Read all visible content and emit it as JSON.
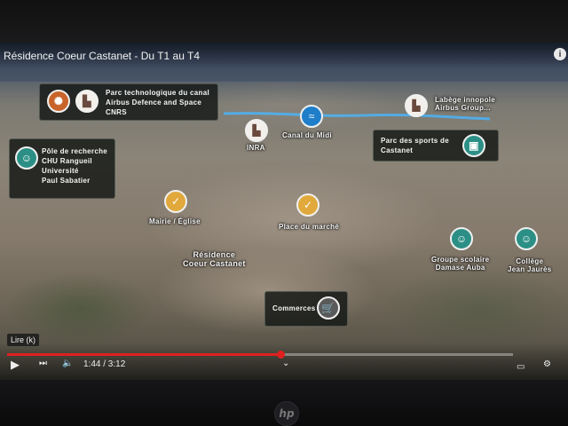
{
  "video": {
    "title": "Résidence Coeur Castanet - Du T1 au T4",
    "info_icon": "info-icon"
  },
  "labels": {
    "parc_techno": [
      "Parc technologique du canal",
      "Airbus Defence and Space",
      "CNRS"
    ],
    "labege": [
      "Labège innopole",
      "Airbus Group..."
    ],
    "canal": "Canal du Midi",
    "inra": "INRA",
    "parc_sports": [
      "Parc des sports de",
      "Castanet"
    ],
    "pole_recherche": [
      "Pôle de recherche",
      "CHU Rangueil",
      "",
      "Université",
      "Paul Sabatier"
    ],
    "mairie": "Mairie / Église",
    "place_marche": "Place du marché",
    "residence": [
      "Résidence",
      "Coeur Castanet"
    ],
    "groupe_scolaire": [
      "Groupe scolaire",
      "Damase Auba"
    ],
    "college": [
      "Collège",
      "Jean Jaurès"
    ],
    "commerces": "Commerces"
  },
  "player": {
    "tooltip": "Lire (k)",
    "time": "1:44 / 3:12",
    "progress_fraction": 0.54
  },
  "colors": {
    "orange": "#c8642a",
    "teal": "#2c8f86",
    "blue": "#1f7ec9",
    "yellow": "#e1a93c",
    "progress": "#e02020"
  },
  "device": {
    "brand": "hp"
  }
}
